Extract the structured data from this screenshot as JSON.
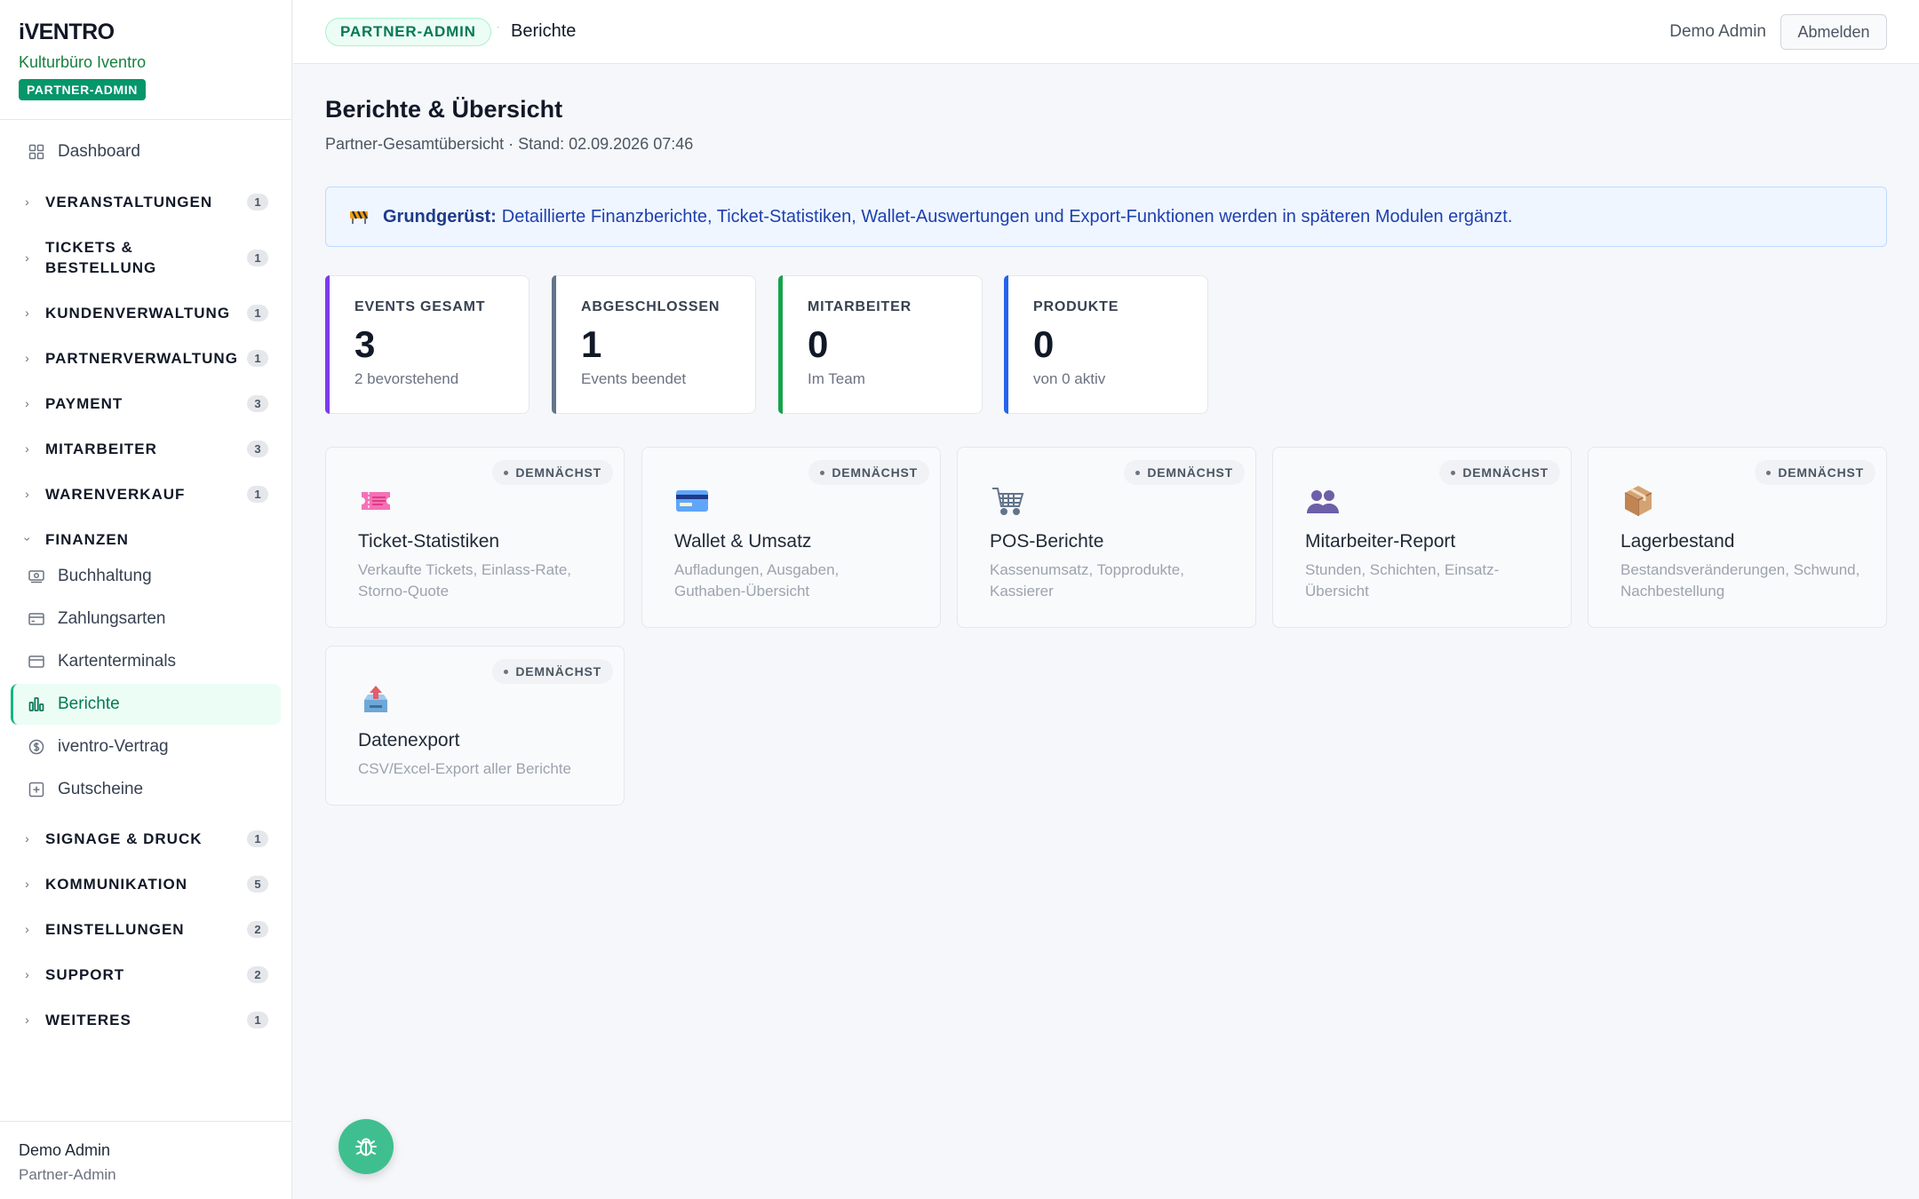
{
  "brand": {
    "logo": "iVENTRO",
    "org": "Kulturbüro Iventro",
    "role": "PARTNER-ADMIN"
  },
  "sidebar": {
    "dashboard": "Dashboard",
    "sections": [
      {
        "label": "VERANSTALTUNGEN",
        "count": "1"
      },
      {
        "label": "TICKETS & BESTELLUNG",
        "line1": "TICKETS &",
        "line2": "BESTELLUNG",
        "count": "1"
      },
      {
        "label": "KUNDENVERWALTUNG",
        "count": "1"
      },
      {
        "label": "PARTNERVERWALTUNG",
        "count": "1"
      },
      {
        "label": "PAYMENT",
        "count": "3"
      },
      {
        "label": "MITARBEITER",
        "count": "3"
      },
      {
        "label": "WARENVERKAUF",
        "count": "1"
      },
      {
        "label": "FINANZEN"
      },
      {
        "label": "SIGNAGE & DRUCK",
        "count": "1"
      },
      {
        "label": "KOMMUNIKATION",
        "count": "5"
      },
      {
        "label": "EINSTELLUNGEN",
        "count": "2"
      },
      {
        "label": "SUPPORT",
        "count": "2"
      },
      {
        "label": "WEITERES",
        "count": "1"
      }
    ],
    "finanzen_items": [
      {
        "label": "Buchhaltung",
        "icon": "cash-icon"
      },
      {
        "label": "Zahlungsarten",
        "icon": "card-icon"
      },
      {
        "label": "Kartenterminals",
        "icon": "terminal-icon"
      },
      {
        "label": "Berichte",
        "icon": "chart-icon",
        "active": true
      },
      {
        "label": "iventro-Vertrag",
        "icon": "dollar-icon"
      },
      {
        "label": "Gutscheine",
        "icon": "voucher-icon"
      }
    ],
    "footer": {
      "name": "Demo Admin",
      "role": "Partner-Admin"
    }
  },
  "topbar": {
    "role_pill": "PARTNER-ADMIN",
    "separator": "·",
    "breadcrumb": "Berichte",
    "user": "Demo Admin",
    "logout": "Abmelden"
  },
  "page": {
    "title": "Berichte & Übersicht",
    "subtitle": "Partner-Gesamtübersicht · Stand: 02.09.2026 07:46"
  },
  "notice": {
    "strong": "Grundgerüst:",
    "text": "Detaillierte Finanzberichte, Ticket-Statistiken, Wallet-Auswertungen und Export-Funktionen werden in späteren Modulen ergänzt."
  },
  "stats": [
    {
      "label": "EVENTS GESAMT",
      "value": "3",
      "sub": "2 bevorstehend",
      "accent": "#7c3aed"
    },
    {
      "label": "ABGESCHLOSSEN",
      "value": "1",
      "sub": "Events beendet",
      "accent": "#64748b"
    },
    {
      "label": "MITARBEITER",
      "value": "0",
      "sub": "Im Team",
      "accent": "#16a34a"
    },
    {
      "label": "PRODUKTE",
      "value": "0",
      "sub": "von 0 aktiv",
      "accent": "#2563eb"
    }
  ],
  "reports": [
    {
      "title": "Ticket-Statistiken",
      "desc": "Verkaufte Tickets, Einlass-Rate, Storno-Quote",
      "badge": "DEMNÄCHST",
      "icon": "ticket-icon"
    },
    {
      "title": "Wallet & Umsatz",
      "desc": "Aufladungen, Ausgaben, Guthaben-Übersicht",
      "badge": "DEMNÄCHST",
      "icon": "credit-card-icon"
    },
    {
      "title": "POS-Berichte",
      "desc": "Kassenumsatz, Topprodukte, Kassierer",
      "badge": "DEMNÄCHST",
      "icon": "shopping-cart-icon"
    },
    {
      "title": "Mitarbeiter-Report",
      "desc": "Stunden, Schichten, Einsatz-Übersicht",
      "badge": "DEMNÄCHST",
      "icon": "people-icon"
    },
    {
      "title": "Lagerbestand",
      "desc": "Bestandsveränderungen, Schwund, Nachbestellung",
      "badge": "DEMNÄCHST",
      "icon": "package-icon"
    },
    {
      "title": "Datenexport",
      "desc": "CSV/Excel-Export aller Berichte",
      "badge": "DEMNÄCHST",
      "icon": "outbox-tray-icon"
    }
  ],
  "colors": {
    "accent_green": "#059669",
    "notice_blue": "#1e40af",
    "fab": "#3fbf8f"
  }
}
